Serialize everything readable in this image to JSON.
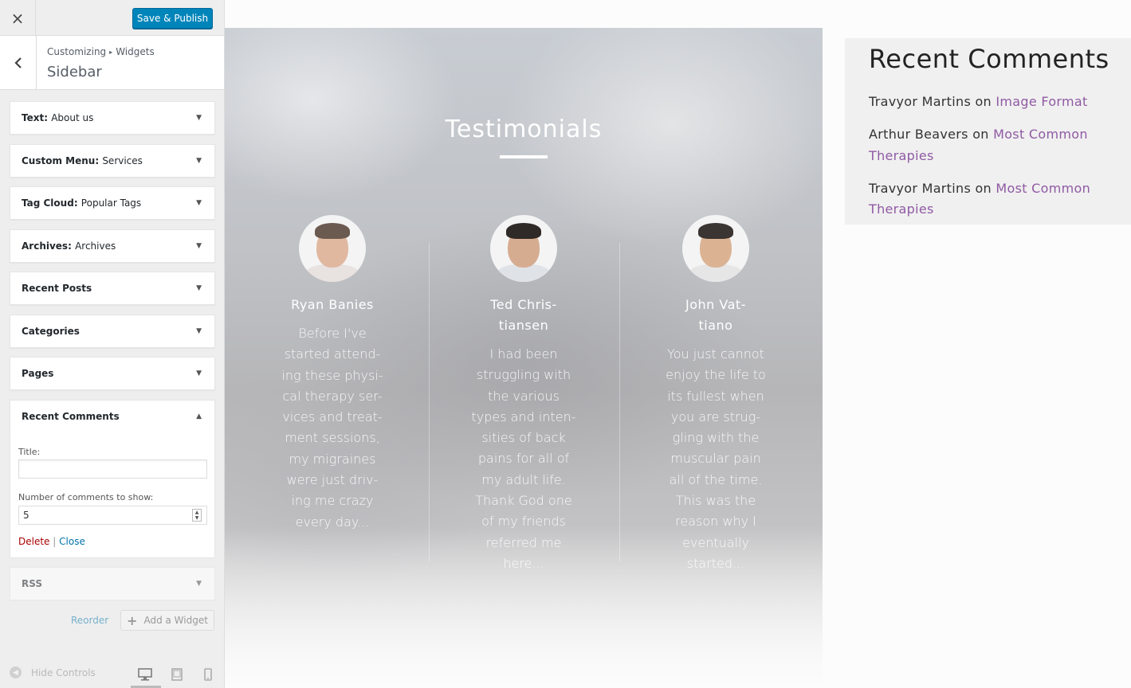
{
  "customizer": {
    "close_glyph": "×",
    "save_label": "Save & Publish",
    "breadcrumb": {
      "root": "Customizing",
      "separator": "▸",
      "current": "Widgets"
    },
    "section_title": "Sidebar",
    "back_glyph": "‹",
    "widgets": [
      {
        "type": "Text",
        "title": "About us"
      },
      {
        "type": "Custom Menu",
        "title": "Services"
      },
      {
        "type": "Tag Cloud",
        "title": "Popular Tags"
      },
      {
        "type": "Archives",
        "title": "Archives"
      },
      {
        "type": "Recent Posts",
        "title": ""
      },
      {
        "type": "Categories",
        "title": ""
      },
      {
        "type": "Pages",
        "title": ""
      },
      {
        "type": "Recent Comments",
        "title": ""
      },
      {
        "type": "RSS",
        "title": ""
      }
    ],
    "open_widget": {
      "title_label": "Title:",
      "title_value": "",
      "count_label": "Number of comments to show:",
      "count_value": "5",
      "delete_label": "Delete",
      "link_separator": "|",
      "close_label": "Close"
    },
    "reorder_label": "Reorder",
    "add_widget_label": "Add a Widget",
    "hide_controls_label": "Hide Controls",
    "devices": [
      "desktop-icon",
      "tablet-icon",
      "mobile-icon"
    ],
    "accent_color": "#0085ba"
  },
  "preview": {
    "testimonials": {
      "title": "Testimonials",
      "people": [
        {
          "name_lines": [
            "Ryan Banies"
          ],
          "quote_lines": [
            "Before I've",
            "started attend-",
            "ing these physi-",
            "cal therapy ser-",
            "vices and treat-",
            "ment sessions,",
            "my migraines",
            "were just driv-",
            "ing me crazy",
            "every day..."
          ]
        },
        {
          "name_lines": [
            "Ted Chris-",
            "tiansen"
          ],
          "quote_lines": [
            "I had been",
            "struggling with",
            "the various",
            "types and inten-",
            "sities of back",
            "pains for all of",
            "my adult life.",
            "Thank God one",
            "of my friends",
            "referred me",
            "here..."
          ]
        },
        {
          "name_lines": [
            "John Vat-",
            "tiano"
          ],
          "quote_lines": [
            "You just cannot",
            "enjoy the life to",
            "its fullest when",
            "you are strug-",
            "gling with the",
            "muscular pain",
            "all of the time.",
            "This was the",
            "reason why I",
            "eventually",
            "started..."
          ]
        }
      ]
    },
    "recent_comments": {
      "title": "Recent Comments",
      "items": [
        {
          "author": "Travyor Martins",
          "on": "on",
          "post": "Image Format"
        },
        {
          "author": "Arthur Beavers",
          "on": "on",
          "post": "Most Common Therapies"
        },
        {
          "author": "Travyor Martins",
          "on": "on",
          "post": "Most Common Therapies"
        }
      ],
      "link_color": "#8f5aa3"
    }
  }
}
